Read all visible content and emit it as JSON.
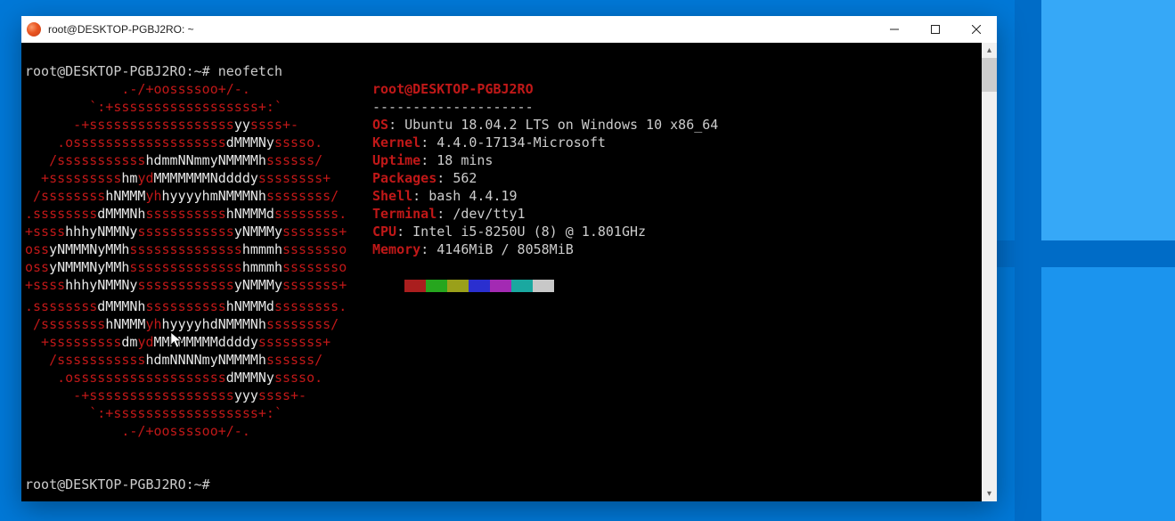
{
  "window": {
    "title": "root@DESKTOP-PGBJ2RO: ~"
  },
  "prompt": {
    "line1_prefix": "root@DESKTOP-PGBJ2RO:~# ",
    "command": "neofetch",
    "line_last": "root@DESKTOP-PGBJ2RO:~# "
  },
  "info": {
    "header": "root@DESKTOP-PGBJ2RO",
    "dashes": "--------------------",
    "os_label": "OS",
    "os_val": "Ubuntu 18.04.2 LTS on Windows 10 x86_64",
    "kernel_label": "Kernel",
    "kernel_val": "4.4.0-17134-Microsoft",
    "uptime_label": "Uptime",
    "uptime_val": "18 mins",
    "packages_label": "Packages",
    "packages_val": "562",
    "shell_label": "Shell",
    "shell_val": "bash 4.4.19",
    "terminal_label": "Terminal",
    "terminal_val": "/dev/tty1",
    "cpu_label": "CPU",
    "cpu_val": "Intel i5-8250U (8) @ 1.801GHz",
    "memory_label": "Memory",
    "memory_val": "4146MiB / 8058MiB"
  },
  "swatches": [
    "#aa1e1e",
    "#26a61e",
    "#9aa01a",
    "#2a2fcf",
    "#a32ab3",
    "#1aa8a0",
    "#c8c8c8"
  ],
  "logo": [
    [
      [
        "r",
        "            .-/+oossssoo+/-.            "
      ]
    ],
    [
      [
        "r",
        "        `:+ssssssssssssssssss+:`        "
      ]
    ],
    [
      [
        "r",
        "      -+ssssssssssssssssss"
      ],
      [
        "w",
        "yy"
      ],
      [
        "r",
        "ssss+-      "
      ]
    ],
    [
      [
        "r",
        "    .osssssssssssssssssss"
      ],
      [
        "w",
        "dMMMNy"
      ],
      [
        "r",
        "sssso.    "
      ]
    ],
    [
      [
        "r",
        "   /sssssssssss"
      ],
      [
        "w",
        "hdmmNNmmyNMMMMh"
      ],
      [
        "r",
        "ssssss/   "
      ]
    ],
    [
      [
        "r",
        "  +sssssssss"
      ],
      [
        "w",
        "hm"
      ],
      [
        "r",
        "yd"
      ],
      [
        "w",
        "MMMMMMMNddddy"
      ],
      [
        "r",
        "ssssssss+  "
      ]
    ],
    [
      [
        "r",
        " /ssssssss"
      ],
      [
        "w",
        "hNMMM"
      ],
      [
        "r",
        "yh"
      ],
      [
        "w",
        "hyyyyhmNMMMNh"
      ],
      [
        "r",
        "ssssssss/ "
      ]
    ],
    [
      [
        "r",
        ".ssssssss"
      ],
      [
        "w",
        "dMMMNh"
      ],
      [
        "r",
        "ssssssssss"
      ],
      [
        "w",
        "hNMMMd"
      ],
      [
        "r",
        "ssssssss."
      ]
    ],
    [
      [
        "r",
        "+ssss"
      ],
      [
        "w",
        "hhhyNMMNy"
      ],
      [
        "r",
        "ssssssssssss"
      ],
      [
        "w",
        "yNMMMy"
      ],
      [
        "r",
        "sssssss+"
      ]
    ],
    [
      [
        "r",
        "oss"
      ],
      [
        "w",
        "yNMMMNyMMh"
      ],
      [
        "r",
        "ssssssssssssss"
      ],
      [
        "w",
        "hmmmh"
      ],
      [
        "r",
        "ssssssso"
      ]
    ],
    [
      [
        "r",
        "oss"
      ],
      [
        "w",
        "yNMMMNyMMh"
      ],
      [
        "r",
        "ssssssssssssss"
      ],
      [
        "w",
        "hmmmh"
      ],
      [
        "r",
        "ssssssso"
      ]
    ],
    [
      [
        "r",
        "+ssss"
      ],
      [
        "w",
        "hhhyNMMNy"
      ],
      [
        "r",
        "ssssssssssss"
      ],
      [
        "w",
        "yNMMMy"
      ],
      [
        "r",
        "sssssss+"
      ]
    ],
    [
      [
        "r",
        ".ssssssss"
      ],
      [
        "w",
        "dMMMNh"
      ],
      [
        "r",
        "ssssssssss"
      ],
      [
        "w",
        "hNMMMd"
      ],
      [
        "r",
        "ssssssss."
      ]
    ],
    [
      [
        "r",
        " /ssssssss"
      ],
      [
        "w",
        "hNMMM"
      ],
      [
        "r",
        "yh"
      ],
      [
        "w",
        "hyyyyhdNMMMNh"
      ],
      [
        "r",
        "ssssssss/ "
      ]
    ],
    [
      [
        "r",
        "  +sssssssss"
      ],
      [
        "w",
        "dm"
      ],
      [
        "r",
        "yd"
      ],
      [
        "w",
        "MMMMMMMMddddy"
      ],
      [
        "r",
        "ssssssss+  "
      ]
    ],
    [
      [
        "r",
        "   /sssssssssss"
      ],
      [
        "w",
        "hdmNNNNmyNMMMMh"
      ],
      [
        "r",
        "ssssss/   "
      ]
    ],
    [
      [
        "r",
        "    .osssssssssssssssssss"
      ],
      [
        "w",
        "dMMMNy"
      ],
      [
        "r",
        "sssso.    "
      ]
    ],
    [
      [
        "r",
        "      -+ssssssssssssssssss"
      ],
      [
        "w",
        "yyy"
      ],
      [
        "r",
        "ssss+-     "
      ]
    ],
    [
      [
        "r",
        "        `:+ssssssssssssssssss+:`        "
      ]
    ],
    [
      [
        "r",
        "            .-/+oossssoo+/-.            "
      ]
    ]
  ]
}
